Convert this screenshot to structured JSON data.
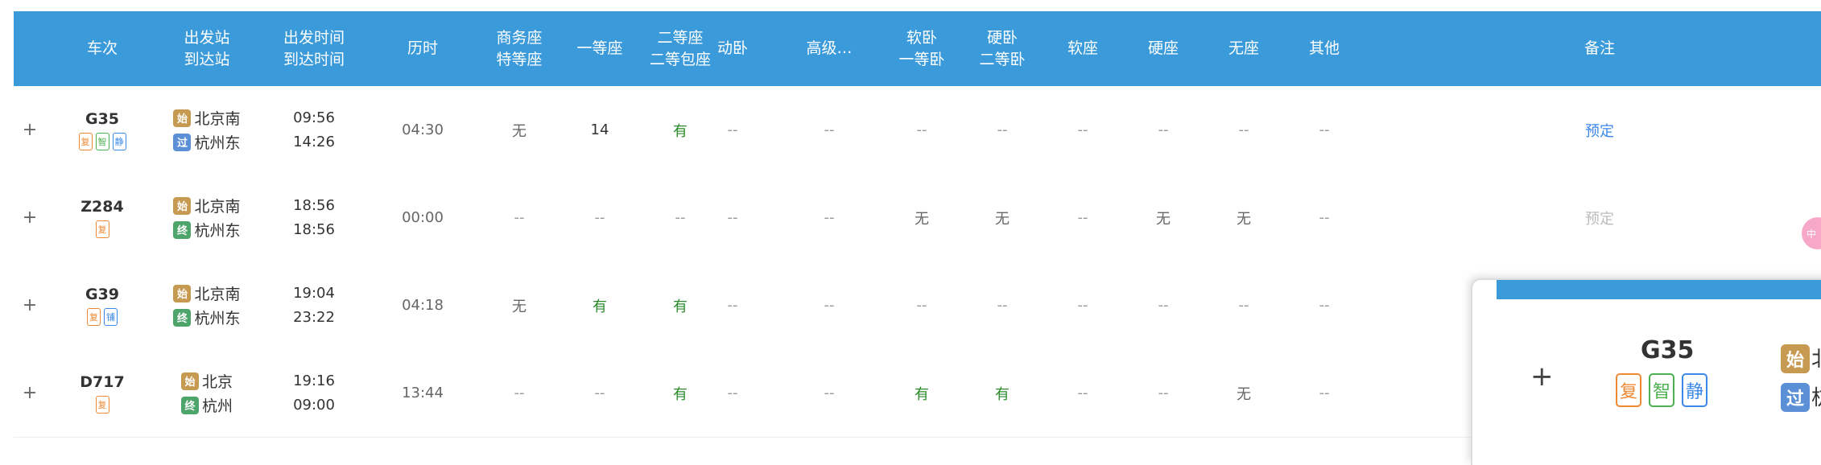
{
  "headers": {
    "expand": "",
    "train_no": "车次",
    "stations": [
      "出发站",
      "到达站"
    ],
    "times": [
      "出发时间",
      "到达时间"
    ],
    "duration": "历时",
    "business": [
      "商务座",
      "特等座"
    ],
    "first": "一等座",
    "second": [
      "二等座",
      "二等包座"
    ],
    "sleeper_dong": "动卧",
    "gaoji": "高级…",
    "soft_sleeper": [
      "软卧",
      "一等卧"
    ],
    "hard_sleeper": [
      "硬卧",
      "二等卧"
    ],
    "soft_seat": "软座",
    "hard_seat": "硬座",
    "no_seat": "无座",
    "other": "其他",
    "remark": "备注"
  },
  "rows": [
    {
      "expand": "+",
      "train": "G35",
      "tags": [
        [
          "复",
          "orange"
        ],
        [
          "智",
          "green"
        ],
        [
          "静",
          "blue"
        ]
      ],
      "from_badge": "始",
      "from": "北京南",
      "to_badge": "过",
      "to": "杭州东",
      "depart": "09:56",
      "arrive": "14:26",
      "duration": "04:30",
      "seats": [
        "无",
        "14",
        "有",
        "--",
        "--",
        "--",
        "--",
        "--",
        "--",
        "--",
        "--"
      ],
      "book": "预定"
    },
    {
      "expand": "+",
      "train": "Z284",
      "tags": [
        [
          "复",
          "orange"
        ]
      ],
      "from_badge": "始",
      "from": "北京南",
      "to_badge": "终",
      "to": "杭州东",
      "depart": "18:56",
      "arrive": "18:56",
      "duration": "00:00",
      "seats": [
        "--",
        "--",
        "--",
        "--",
        "--",
        "无",
        "无",
        "--",
        "无",
        "无",
        "--"
      ],
      "book": "预定"
    },
    {
      "expand": "+",
      "train": "G39",
      "tags": [
        [
          "复",
          "orange"
        ],
        [
          "铺",
          "blue"
        ]
      ],
      "from_badge": "始",
      "from": "北京南",
      "to_badge": "终",
      "to": "杭州东",
      "depart": "19:04",
      "arrive": "23:22",
      "duration": "04:18",
      "seats": [
        "无",
        "有",
        "有",
        "--",
        "--",
        "--",
        "--",
        "--",
        "--",
        "--",
        "--"
      ],
      "book": ""
    },
    {
      "expand": "+",
      "train": "D717",
      "tags": [
        [
          "复",
          "orange"
        ]
      ],
      "from_badge": "始",
      "from": "北京",
      "to_badge": "终",
      "to": "杭州",
      "depart": "19:16",
      "arrive": "09:00",
      "duration": "13:44",
      "seats": [
        "--",
        "--",
        "有",
        "--",
        "--",
        "有",
        "有",
        "--",
        "--",
        "无",
        "--"
      ],
      "book": ""
    }
  ],
  "pink_dot_label": "中",
  "zoom": {
    "plus": "+",
    "train": "G35",
    "tags": [
      "复",
      "智",
      "静"
    ],
    "from_badge": "始",
    "pass_badge": "过",
    "from_peek": "北",
    "to_peek": "杭"
  },
  "colors": {
    "header_bg": "#3b9ad9",
    "has_seat": "#2a8a2a",
    "link": "#3b88e8",
    "start_badge": "#c79a52",
    "pass_badge": "#5b8fd6",
    "end_badge": "#4ea56b"
  }
}
